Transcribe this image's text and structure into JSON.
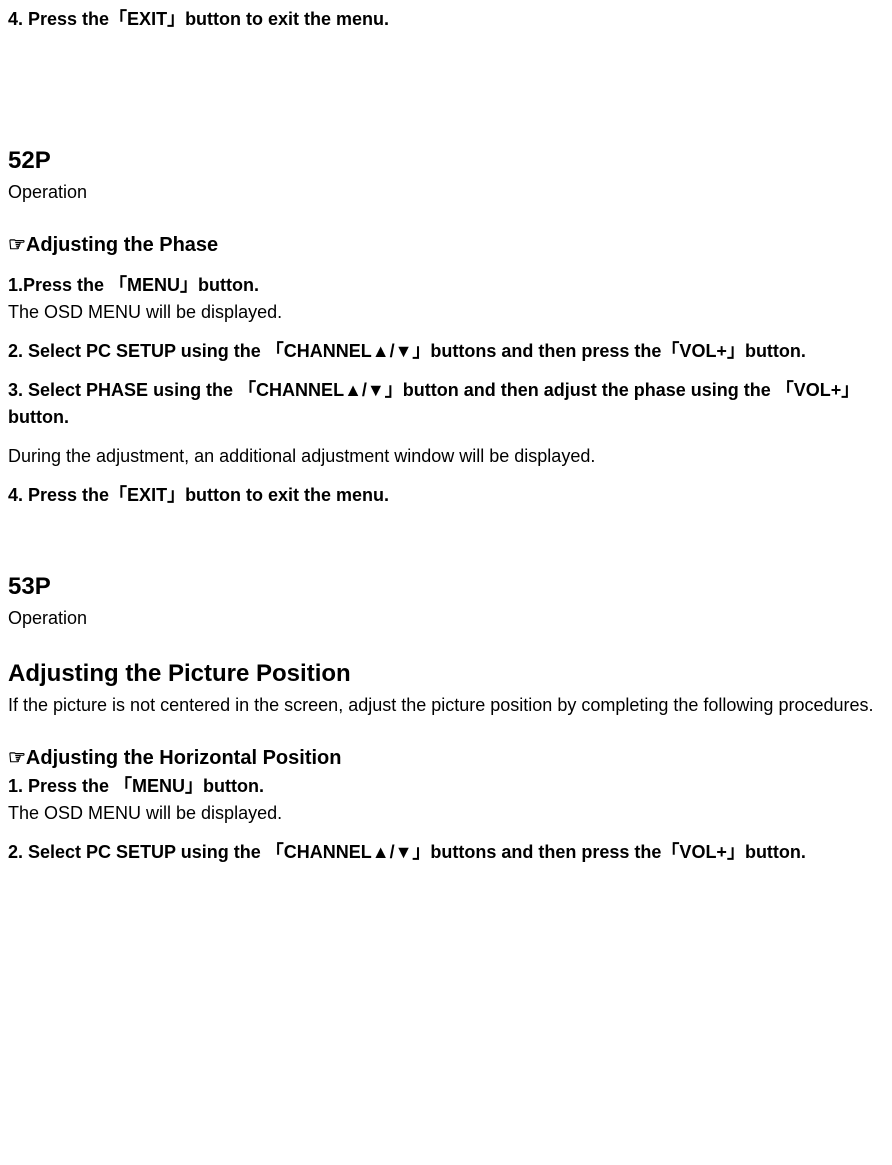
{
  "page51": {
    "step4": "4. Press the「EXIT」button to exit the menu."
  },
  "page52": {
    "pageNum": "52P",
    "subTitle": "Operation",
    "phaseHeading": "☞Adjusting the Phase",
    "step1_title": "1.Press the 「MENU」button.",
    "step1_body": "The OSD MENU will be displayed.",
    "step2_a": "2. Select PC SETUP using the 「CHANNEL",
    "step2_mid": "/",
    "step2_b": "」buttons and then press the「VOL+」button.",
    "step3_a": "3. Select PHASE using the 「CHANNEL",
    "step3_mid": "/",
    "step3_b": "」button and then adjust the phase using the 「VOL+」button.",
    "adjustNote": "During the adjustment, an additional adjustment window will be displayed.",
    "step4": "4. Press the「EXIT」button to exit the menu."
  },
  "page53": {
    "pageNum": "53P",
    "subTitle": "Operation",
    "title": "Adjusting the Picture Position",
    "intro": "If the picture is not centered in the screen, adjust the picture position by completing the following procedures.",
    "hHeading": "☞Adjusting the Horizontal Position",
    "hStep1_title": "1. Press the 「MENU」button.",
    "hStep1_body": "The OSD MENU will be displayed.",
    "hStep2_a": "2. Select PC SETUP using the 「CHANNEL",
    "hStep2_mid": "/",
    "hStep2_b": "」buttons and then press the「VOL+」button."
  },
  "icons": {
    "up": "▲",
    "down": "▼"
  }
}
